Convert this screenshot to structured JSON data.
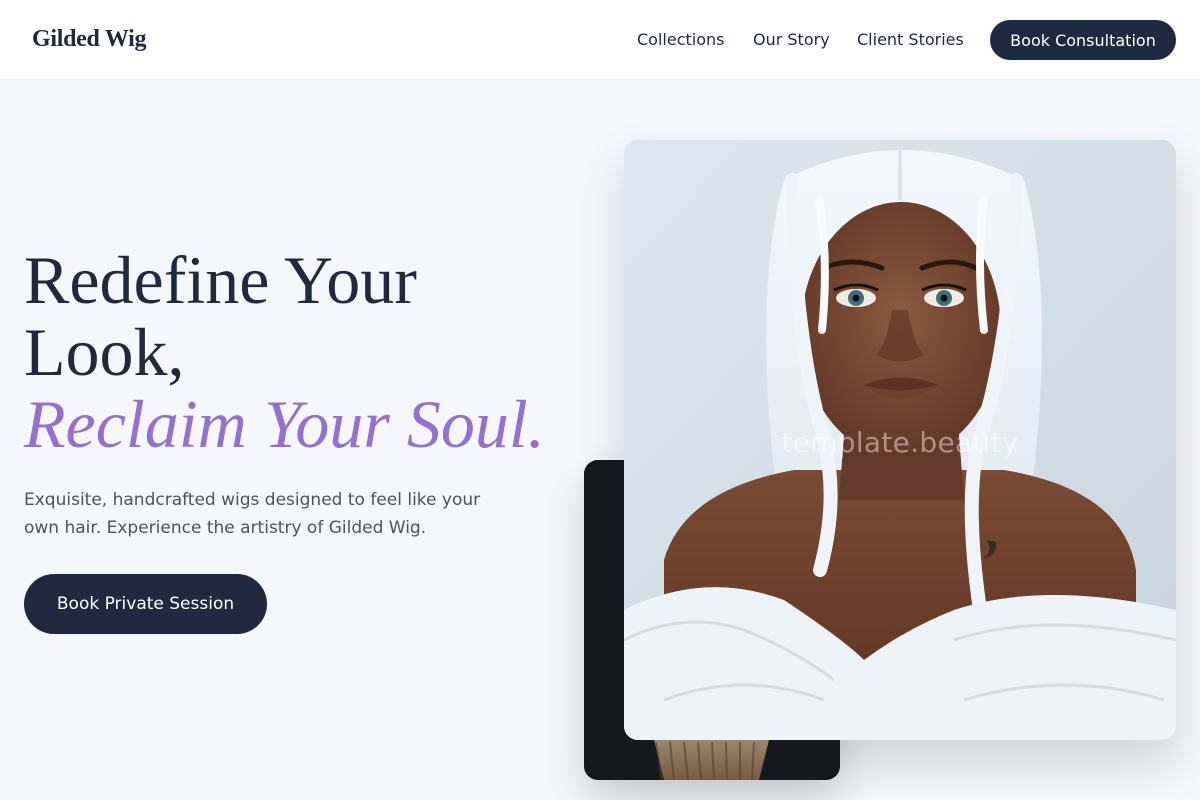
{
  "brand": {
    "name": "Gilded Wig"
  },
  "nav": {
    "links": [
      {
        "label": "Collections"
      },
      {
        "label": "Our Story"
      },
      {
        "label": "Client Stories"
      }
    ],
    "cta_label": "Book Consultation"
  },
  "hero": {
    "title_line1": "Redefine Your",
    "title_line2": "Look,",
    "title_accent": "Reclaim Your Soul.",
    "subtitle": "Exquisite, handcrafted wigs designed to feel like your own hair. Experience the artistry of Gilded Wig.",
    "cta_label": "Book Private Session"
  },
  "images": {
    "main_alt": "Model wearing a long platinum white wig and white fur",
    "watermark": "template.beauty"
  },
  "colors": {
    "primary": "#1f2940",
    "accent": "#9470d0",
    "background": "#f6f7fc"
  }
}
